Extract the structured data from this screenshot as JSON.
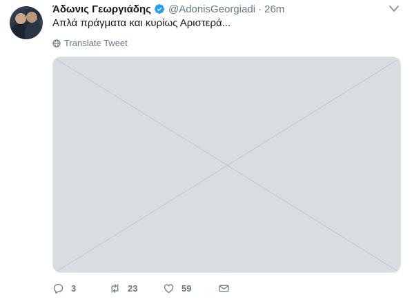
{
  "tweet": {
    "author_name": "Άδωνις Γεωργιάδης",
    "handle": "@AdonisGeorgiadi",
    "separator": "·",
    "time": "26m",
    "text": "Απλά πράγματα και κυρίως Αριστερά...",
    "translate_label": "Translate Tweet"
  },
  "actions": {
    "replies": "3",
    "retweets": "23",
    "likes": "59"
  },
  "colors": {
    "verified": "#1da1f2",
    "muted": "#657786",
    "text": "#14171a"
  }
}
